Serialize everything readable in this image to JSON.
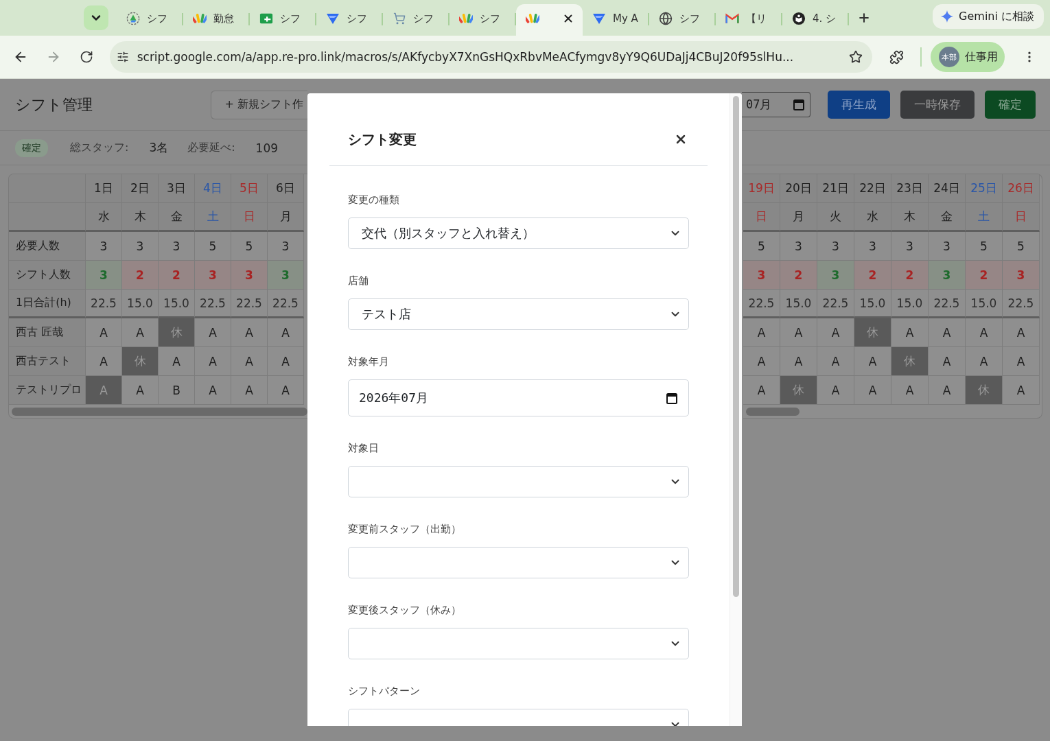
{
  "browser": {
    "tabs": [
      {
        "kind": "drive",
        "title": "シフ",
        "selected": false
      },
      {
        "kind": "script",
        "title": "勤怠",
        "selected": false
      },
      {
        "kind": "sheets",
        "title": "シフ",
        "selected": false
      },
      {
        "kind": "triangle",
        "title": "シフ",
        "selected": false
      },
      {
        "kind": "cart",
        "title": "シフ",
        "selected": false
      },
      {
        "kind": "script",
        "title": "シフ",
        "selected": false
      },
      {
        "kind": "script",
        "selected": true
      },
      {
        "kind": "triangle",
        "title": "My A",
        "selected": false
      },
      {
        "kind": "globe",
        "title": "シフ",
        "selected": false
      },
      {
        "kind": "gmail",
        "title": "【リ",
        "selected": false
      },
      {
        "kind": "book",
        "title": "4. シ",
        "selected": false
      }
    ],
    "gemini": "Gemini に相談",
    "url": "script.google.com/a/app.re-pro.link/macros/s/AKfycbyX7XnGsHQxRbvMeACfymgv8yY9Q6UDaJj4CBuJ20f95slHu...",
    "profile": {
      "avatar": "本部",
      "label": "仕事用"
    }
  },
  "page": {
    "title": "シフト管理",
    "new_button": "+ 新規シフト作",
    "month_field": "07月",
    "buttons": [
      {
        "label": "再生成",
        "kind": "primary"
      },
      {
        "label": "一時保存",
        "kind": "secondary"
      },
      {
        "label": "確定",
        "kind": "success"
      }
    ],
    "status_badge": "確定",
    "stats": [
      {
        "label": "総スタッフ:",
        "value": "3名"
      },
      {
        "label": "必要延べ:",
        "value": "109"
      }
    ]
  },
  "schedule": {
    "row_labels": {
      "required": "必要人数",
      "shift": "シフト人数",
      "hours": "1日合計(h)"
    },
    "staff_names": [
      "西古 匠哉",
      "西古テスト",
      "テストリプロ"
    ],
    "left_columns": [
      {
        "day": "1日",
        "weekday": "水",
        "kind": "weekday",
        "required": "3",
        "shift": {
          "value": "3",
          "met": true
        },
        "hours": "22.5",
        "staff": [
          {
            "value": "A",
            "shaded": false
          },
          {
            "value": "A",
            "shaded": false
          },
          {
            "value": "A",
            "shaded": true
          }
        ]
      },
      {
        "day": "2日",
        "weekday": "木",
        "kind": "weekday",
        "required": "3",
        "shift": {
          "value": "2",
          "met": false
        },
        "hours": "15.0",
        "staff": [
          {
            "value": "A",
            "shaded": false
          },
          {
            "value": "休",
            "shaded": true
          },
          {
            "value": "A",
            "shaded": false
          }
        ]
      },
      {
        "day": "3日",
        "weekday": "金",
        "kind": "weekday",
        "required": "3",
        "shift": {
          "value": "2",
          "met": false
        },
        "hours": "15.0",
        "staff": [
          {
            "value": "休",
            "shaded": true
          },
          {
            "value": "A",
            "shaded": false
          },
          {
            "value": "B",
            "shaded": false
          }
        ]
      },
      {
        "day": "4日",
        "weekday": "土",
        "kind": "saturday",
        "required": "5",
        "shift": {
          "value": "3",
          "met": false
        },
        "hours": "22.5",
        "staff": [
          {
            "value": "A",
            "shaded": false
          },
          {
            "value": "A",
            "shaded": false
          },
          {
            "value": "A",
            "shaded": false
          }
        ]
      },
      {
        "day": "5日",
        "weekday": "日",
        "kind": "sunday",
        "required": "5",
        "shift": {
          "value": "3",
          "met": false
        },
        "hours": "22.5",
        "staff": [
          {
            "value": "A",
            "shaded": false
          },
          {
            "value": "A",
            "shaded": false
          },
          {
            "value": "A",
            "shaded": false
          }
        ]
      },
      {
        "day": "6日",
        "weekday": "月",
        "kind": "weekday",
        "required": "3",
        "shift": {
          "value": "3",
          "met": true
        },
        "hours": "22.5",
        "staff": [
          {
            "value": "A",
            "shaded": false
          },
          {
            "value": "A",
            "shaded": false
          },
          {
            "value": "A",
            "shaded": false
          }
        ]
      }
    ],
    "right_columns": [
      {
        "day": "19日",
        "weekday": "日",
        "kind": "sunday",
        "required": "5",
        "shift": {
          "value": "3",
          "met": false
        },
        "hours": "22.5",
        "staff": [
          {
            "value": "A",
            "shaded": false
          },
          {
            "value": "A",
            "shaded": false
          },
          {
            "value": "A",
            "shaded": false
          }
        ]
      },
      {
        "day": "20日",
        "weekday": "月",
        "kind": "weekday",
        "required": "3",
        "shift": {
          "value": "2",
          "met": false
        },
        "hours": "15.0",
        "staff": [
          {
            "value": "A",
            "shaded": false
          },
          {
            "value": "A",
            "shaded": false
          },
          {
            "value": "休",
            "shaded": true
          }
        ]
      },
      {
        "day": "21日",
        "weekday": "火",
        "kind": "weekday",
        "required": "3",
        "shift": {
          "value": "3",
          "met": true
        },
        "hours": "22.5",
        "staff": [
          {
            "value": "A",
            "shaded": false
          },
          {
            "value": "A",
            "shaded": false
          },
          {
            "value": "A",
            "shaded": false
          }
        ]
      },
      {
        "day": "22日",
        "weekday": "水",
        "kind": "weekday",
        "required": "3",
        "shift": {
          "value": "2",
          "met": false
        },
        "hours": "15.0",
        "staff": [
          {
            "value": "休",
            "shaded": true
          },
          {
            "value": "A",
            "shaded": false
          },
          {
            "value": "A",
            "shaded": false
          }
        ]
      },
      {
        "day": "23日",
        "weekday": "木",
        "kind": "weekday",
        "required": "3",
        "shift": {
          "value": "2",
          "met": false
        },
        "hours": "15.0",
        "staff": [
          {
            "value": "A",
            "shaded": false
          },
          {
            "value": "休",
            "shaded": true
          },
          {
            "value": "A",
            "shaded": false
          }
        ]
      },
      {
        "day": "24日",
        "weekday": "金",
        "kind": "weekday",
        "required": "3",
        "shift": {
          "value": "3",
          "met": true
        },
        "hours": "22.5",
        "staff": [
          {
            "value": "A",
            "shaded": false
          },
          {
            "value": "A",
            "shaded": false
          },
          {
            "value": "A",
            "shaded": false
          }
        ]
      },
      {
        "day": "25日",
        "weekday": "土",
        "kind": "saturday",
        "required": "5",
        "shift": {
          "value": "2",
          "met": false
        },
        "hours": "15.0",
        "staff": [
          {
            "value": "A",
            "shaded": false
          },
          {
            "value": "A",
            "shaded": false
          },
          {
            "value": "休",
            "shaded": true
          }
        ]
      },
      {
        "day": "26日",
        "weekday": "日",
        "kind": "sunday",
        "required": "5",
        "shift": {
          "value": "3",
          "met": false
        },
        "hours": "22.5",
        "staff": [
          {
            "value": "A",
            "shaded": false
          },
          {
            "value": "A",
            "shaded": false
          },
          {
            "value": "A",
            "shaded": false
          }
        ]
      }
    ]
  },
  "modal": {
    "title": "シフト変更",
    "fields": [
      {
        "label": "変更の種類",
        "kind": "select",
        "value": "交代（別スタッフと入れ替え）"
      },
      {
        "label": "店舗",
        "kind": "select",
        "value": "テスト店"
      },
      {
        "label": "対象年月",
        "kind": "month",
        "value": "2026年07月"
      },
      {
        "label": "対象日",
        "kind": "select"
      },
      {
        "label": "変更前スタッフ（出勤）",
        "kind": "select"
      },
      {
        "label": "変更後スタッフ（休み）",
        "kind": "select"
      },
      {
        "label": "シフトパターン",
        "kind": "select"
      }
    ]
  }
}
